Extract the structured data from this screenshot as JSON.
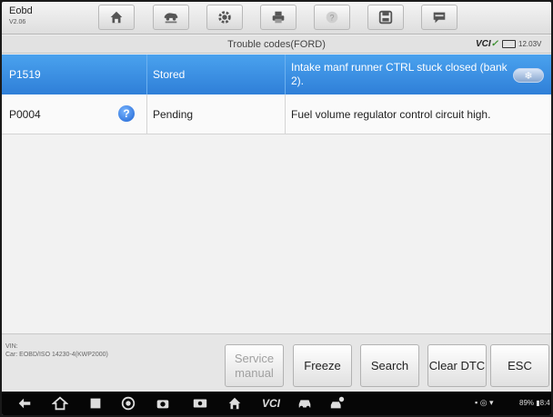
{
  "app": {
    "title": "Eobd",
    "version": "V2.06"
  },
  "toolbar": {
    "buttons": [
      {
        "icon": "home-icon"
      },
      {
        "icon": "vehicle-lift-icon"
      },
      {
        "icon": "gear-icon"
      },
      {
        "icon": "printer-icon"
      },
      {
        "icon": "help-icon"
      },
      {
        "icon": "save-icon"
      },
      {
        "icon": "chat-icon"
      }
    ]
  },
  "header": {
    "title": "Trouble codes(FORD)",
    "vci_label": "VCI",
    "battery_voltage": "12.03V"
  },
  "dtc_rows": [
    {
      "code": "P1519",
      "status": "Stored",
      "description": "Intake manf runner CTRL stuck closed (bank 2).",
      "selected": true,
      "freeze_badge": "❄"
    },
    {
      "code": "P0004",
      "status": "Pending",
      "description": "Fuel volume regulator control circuit high.",
      "selected": false,
      "help_icon": "?"
    }
  ],
  "footer": {
    "vin_label": "VIN:",
    "car_label": "Car: EOBD/ISO 14230-4(KWP2000)",
    "buttons": {
      "service_manual": "Service manual",
      "freeze": "Freeze",
      "search": "Search",
      "clear_dtc": "Clear DTC",
      "esc": "ESC"
    }
  },
  "navbar": {
    "icons": [
      "back-icon",
      "home-icon",
      "recent-apps-icon",
      "chrome-icon",
      "camera-icon",
      "screen-record-icon",
      "maxisys-home-icon",
      "vci-icon",
      "car-icon",
      "car-service-icon"
    ],
    "vci_text": "VCI",
    "status_text": "89% ▮8:4"
  }
}
